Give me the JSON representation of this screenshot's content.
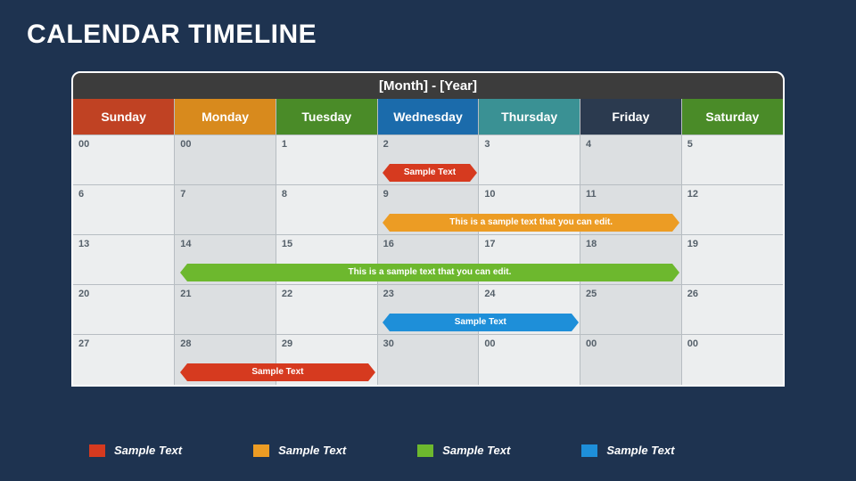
{
  "title": "CALENDAR TIMELINE",
  "calendarHeader": "[Month] - [Year]",
  "days": [
    "Sunday",
    "Monday",
    "Tuesday",
    "Wednesday",
    "Thursday",
    "Friday",
    "Saturday"
  ],
  "rows": [
    {
      "cells": [
        "00",
        "00",
        "1",
        "2",
        "3",
        "4",
        "5"
      ],
      "alt": [
        0,
        1,
        0,
        1,
        0,
        1,
        0
      ]
    },
    {
      "cells": [
        "6",
        "7",
        "8",
        "9",
        "10",
        "11",
        "12"
      ],
      "alt": [
        0,
        1,
        0,
        1,
        0,
        1,
        0
      ]
    },
    {
      "cells": [
        "13",
        "14",
        "15",
        "16",
        "17",
        "18",
        "19"
      ],
      "alt": [
        0,
        1,
        0,
        1,
        0,
        1,
        0
      ]
    },
    {
      "cells": [
        "20",
        "21",
        "22",
        "23",
        "24",
        "25",
        "26"
      ],
      "alt": [
        0,
        1,
        0,
        1,
        0,
        1,
        0
      ]
    },
    {
      "cells": [
        "27",
        "28",
        "29",
        "30",
        "00",
        "00",
        "00"
      ],
      "alt": [
        0,
        1,
        0,
        1,
        0,
        1,
        0
      ]
    }
  ],
  "bars": [
    {
      "row": 0,
      "fromCol": 3,
      "toCol": 3,
      "color": "red",
      "text": "Sample Text"
    },
    {
      "row": 1,
      "fromCol": 3,
      "toCol": 5,
      "color": "orange",
      "text": "This is a sample text that you can edit."
    },
    {
      "row": 2,
      "fromCol": 1,
      "toCol": 5,
      "color": "green",
      "text": "This is a sample text that you can edit."
    },
    {
      "row": 3,
      "fromCol": 3,
      "toCol": 4,
      "color": "blue",
      "text": "Sample Text"
    },
    {
      "row": 4,
      "fromCol": 1,
      "toCol": 2,
      "color": "red",
      "text": "Sample Text"
    }
  ],
  "legend": [
    {
      "color": "#d63a1f",
      "label": "Sample Text"
    },
    {
      "color": "#ec9c24",
      "label": "Sample Text"
    },
    {
      "color": "#6db82e",
      "label": "Sample Text"
    },
    {
      "color": "#1e8fd9",
      "label": "Sample Text"
    }
  ]
}
